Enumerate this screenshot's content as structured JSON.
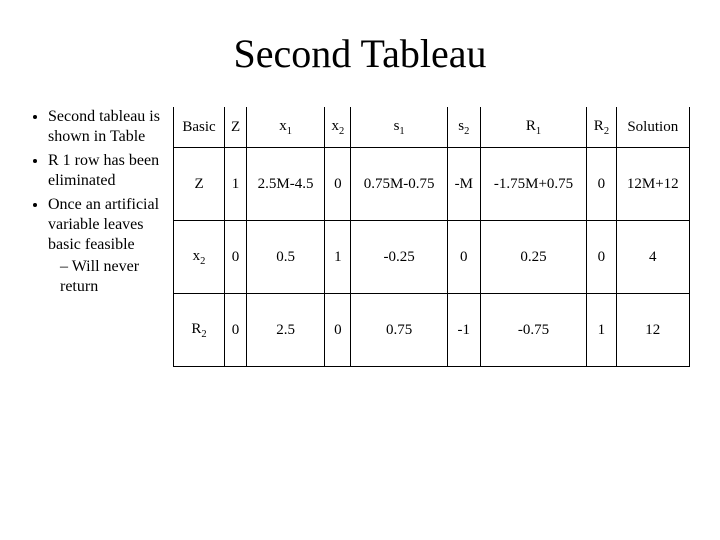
{
  "title": "Second Tableau",
  "bullets": {
    "items": [
      "Second tableau is shown in Table",
      "R 1 row has been eliminated",
      "Once an artificial variable leaves basic feasible"
    ],
    "sub": "Will never return"
  },
  "table": {
    "headers": [
      "Basic",
      "Z",
      "x1",
      "x2",
      "s1",
      "s2",
      "R1",
      "R2",
      "Solution"
    ],
    "rows": [
      [
        "Z",
        "1",
        "2.5M-4.5",
        "0",
        "0.75M-0.75",
        "-M",
        "-1.75M+0.75",
        "0",
        "12M+12"
      ],
      [
        "x2",
        "0",
        "0.5",
        "1",
        "-0.25",
        "0",
        "0.25",
        "0",
        "4"
      ],
      [
        "R2",
        "0",
        "2.5",
        "0",
        "0.75",
        "-1",
        "-0.75",
        "1",
        "12"
      ]
    ]
  },
  "chart_data": {
    "type": "table",
    "title": "Second Tableau",
    "columns": [
      "Basic",
      "Z",
      "x1",
      "x2",
      "s1",
      "s2",
      "R1",
      "R2",
      "Solution"
    ],
    "rows": [
      {
        "Basic": "Z",
        "Z": 1,
        "x1": "2.5M-4.5",
        "x2": 0,
        "s1": "0.75M-0.75",
        "s2": "-M",
        "R1": "-1.75M+0.75",
        "R2": 0,
        "Solution": "12M+12"
      },
      {
        "Basic": "x2",
        "Z": 0,
        "x1": 0.5,
        "x2": 1,
        "s1": -0.25,
        "s2": 0,
        "R1": 0.25,
        "R2": 0,
        "Solution": 4
      },
      {
        "Basic": "R2",
        "Z": 0,
        "x1": 2.5,
        "x2": 0,
        "s1": 0.75,
        "s2": -1,
        "R1": -0.75,
        "R2": 1,
        "Solution": 12
      }
    ]
  }
}
